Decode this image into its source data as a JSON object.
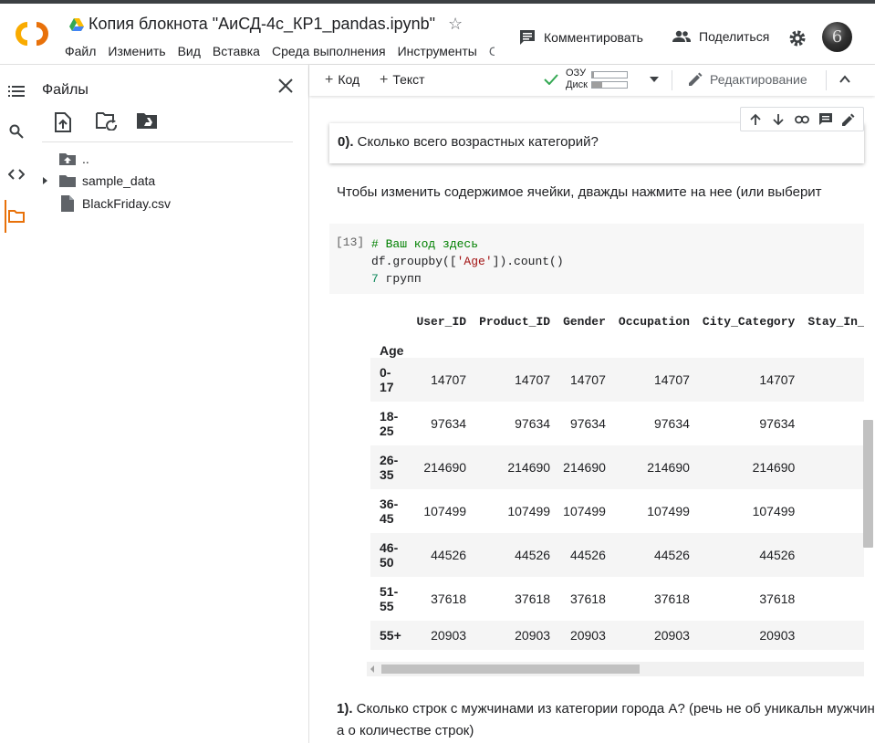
{
  "header": {
    "doc_title": "Копия блокнота \"АиСД-4с_КР1_pandas.ipynb\"",
    "menu": [
      "Файл",
      "Изменить",
      "Вид",
      "Вставка",
      "Среда выполнения",
      "Инструменты"
    ],
    "comment_label": "Комментировать",
    "share_label": "Поделиться",
    "avatar_letter": "6"
  },
  "files_panel": {
    "title": "Файлы",
    "tree": [
      {
        "name": "..",
        "type": "parent-folder"
      },
      {
        "name": "sample_data",
        "type": "folder"
      },
      {
        "name": "BlackFriday.csv",
        "type": "file"
      }
    ]
  },
  "notebook_toolbar": {
    "add_code": "Код",
    "add_text": "Текст",
    "ram_label": "ОЗУ",
    "disk_label": "Диск",
    "ram_usage": 0.05,
    "disk_usage": 0.3,
    "edit_mode": "Редактирование"
  },
  "cells": {
    "question0_num": "0).",
    "question0_text": " Сколько всего возрастных категорий?",
    "hint": "Чтобы изменить содержимое ячейки, дважды нажмите на нее (или выберит",
    "exec_count": "[13]",
    "code_line1": "# Ваш код здесь",
    "code_line2_a": "df.groupby([",
    "code_line2_str": "'Age'",
    "code_line2_b": "]).count()",
    "code_line3_num": "7",
    "code_line3_text": " групп",
    "question1_num": "1).",
    "question1_text": " Сколько строк с мужчинами из категории города А? (речь не об уникальн мужчин, а о количестве строк)"
  },
  "table": {
    "columns": [
      "User_ID",
      "Product_ID",
      "Gender",
      "Occupation",
      "City_Category",
      "Stay_In_C"
    ],
    "index_name": "Age",
    "rows": [
      {
        "index": "0-\n17",
        "values": [
          "14707",
          "14707",
          "14707",
          "14707",
          "14707"
        ]
      },
      {
        "index": "18-\n25",
        "values": [
          "97634",
          "97634",
          "97634",
          "97634",
          "97634"
        ]
      },
      {
        "index": "26-\n35",
        "values": [
          "214690",
          "214690",
          "214690",
          "214690",
          "214690"
        ]
      },
      {
        "index": "36-\n45",
        "values": [
          "107499",
          "107499",
          "107499",
          "107499",
          "107499"
        ]
      },
      {
        "index": "46-\n50",
        "values": [
          "44526",
          "44526",
          "44526",
          "44526",
          "44526"
        ]
      },
      {
        "index": "51-\n55",
        "values": [
          "37618",
          "37618",
          "37618",
          "37618",
          "37618"
        ]
      },
      {
        "index": "55+",
        "values": [
          "20903",
          "20903",
          "20903",
          "20903",
          "20903"
        ]
      }
    ]
  },
  "colors": {
    "accent": "#e8710a",
    "logo_orange": "#f9ab00",
    "connected_green": "#34a853"
  }
}
